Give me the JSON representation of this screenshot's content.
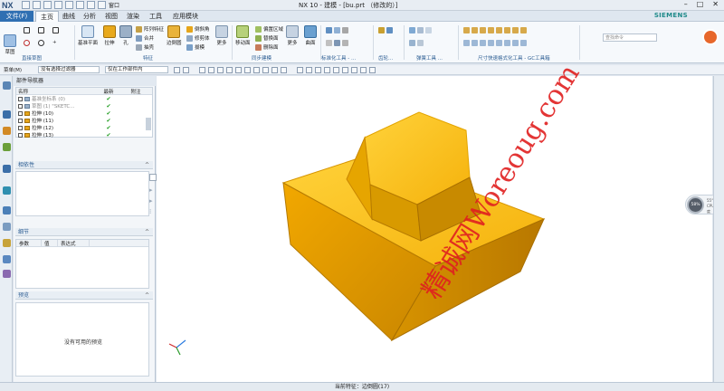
{
  "app": {
    "logo": "NX",
    "title": "NX 10 - 建模 - [bu.prt （修改的）]",
    "brand": "SIEMENS",
    "window_menu": "窗口"
  },
  "menu": {
    "file": "文件(F)",
    "tabs": [
      "主页",
      "曲线",
      "分析",
      "视图",
      "渲染",
      "工具",
      "应用模块"
    ],
    "search_placeholder": "查找命令"
  },
  "ribbon": {
    "sketch_btn": "草图",
    "datum_btn": "基准平面",
    "extrude_btn": "拉伸",
    "hole_btn": "孔",
    "array_feat": "阵列特征",
    "unite": "合并",
    "shell": "抽壳",
    "edge_blend_btn": "边倒圆",
    "chamfer": "倒斜角",
    "mirror_body": "修剪体",
    "draft": "拔模",
    "more1": "更多",
    "move_face_btn": "移动面",
    "replace_region": "偏置区域",
    "replace_face": "替换面",
    "delete_face": "删除面",
    "more2": "更多",
    "surface_btn": "曲面",
    "groups": [
      "直接草图",
      "特征",
      "同步建模",
      "标准化工具 - ...",
      "齿轮...",
      "弹簧工具 ...",
      "尺寸快速格式化工具 - GC工具箱"
    ]
  },
  "toolbar": {
    "menu_label": "菜单(M)",
    "filter": "没有选择过滤器",
    "scope": "仅在工作部件内"
  },
  "navigator": {
    "title": "部件导航器",
    "headers": [
      "名称",
      "最新",
      "附注"
    ],
    "rows": [
      {
        "name": "基准坐标系 (0)",
        "ok": "✔",
        "grey": true
      },
      {
        "name": "草图 (1) \"SKETC...",
        "ok": "✔",
        "grey": true
      },
      {
        "name": "拉伸 (10)",
        "ok": "✔",
        "grey": false
      },
      {
        "name": "拉伸 (11)",
        "ok": "✔",
        "grey": false
      },
      {
        "name": "拉伸 (12)",
        "ok": "✔",
        "grey": false
      },
      {
        "name": "拉伸 (13)",
        "ok": "✔",
        "grey": false
      }
    ],
    "dependency": "相依性",
    "details": "细节",
    "details_headers": [
      "参数",
      "值",
      "表达式"
    ],
    "preview": "预览",
    "preview_msg": "没有可用的预览"
  },
  "status": {
    "text": "当前特征：边倒圆(17)"
  },
  "cpu": {
    "value": "58%",
    "temp": "55°C",
    "label": "CPU温度"
  },
  "watermark": "精诚网Woreoug.com",
  "colors": {
    "accent": "#2f6fb2",
    "model": "#f2b10f",
    "model_dark": "#c98600"
  }
}
